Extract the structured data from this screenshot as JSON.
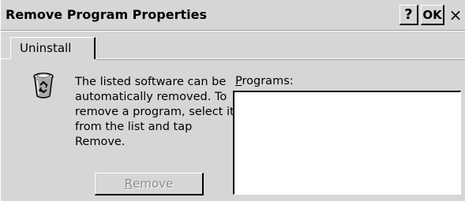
{
  "window": {
    "title": "Remove Program Properties",
    "help_label": "?",
    "ok_label": "OK",
    "close_label": "×"
  },
  "tabs": [
    {
      "label": "Uninstall",
      "selected": true
    }
  ],
  "content": {
    "icon": "recycle-bin-icon",
    "description_lines": [
      "The listed software can be",
      "automatically removed. To",
      "remove a program, select it",
      "from the list and tap",
      "Remove."
    ],
    "programs_label_accel": "P",
    "programs_label_rest": "rograms:",
    "programs": [],
    "remove_button": {
      "accel": "R",
      "rest": "emove",
      "enabled": false
    }
  }
}
